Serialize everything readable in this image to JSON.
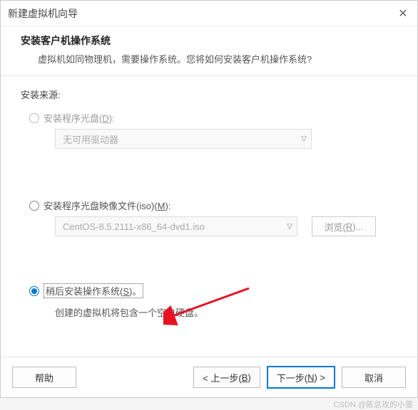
{
  "window": {
    "title": "新建虚拟机向导"
  },
  "header": {
    "title": "安装客户机操作系统",
    "desc": "虚拟机如同物理机，需要操作系统。您将如何安装客户机操作系统?"
  },
  "source_label": "安装来源:",
  "opt_disc": {
    "label_pre": "安装程序光盘(",
    "hotkey": "D",
    "label_post": "):",
    "combo_value": "无可用驱动器"
  },
  "opt_iso": {
    "label_pre": "安装程序光盘映像文件(iso)(",
    "hotkey": "M",
    "label_post": "):",
    "combo_value": "CentOS-8.5.2111-x86_64-dvd1.iso",
    "browse_pre": "浏览(",
    "browse_hotkey": "R",
    "browse_post": ")..."
  },
  "opt_later": {
    "label_pre": "稍后安装操作系统(",
    "hotkey": "S",
    "label_post": ")。",
    "subtext": "创建的虚拟机将包含一个空白硬盘。"
  },
  "footer": {
    "help": "帮助",
    "back_pre": "< 上一步(",
    "back_hotkey": "B",
    "back_post": ")",
    "next_pre": "下一步(",
    "next_hotkey": "N",
    "next_post": ") >",
    "cancel": "取消"
  },
  "watermark": "CSDN @陈总攻的小雯"
}
